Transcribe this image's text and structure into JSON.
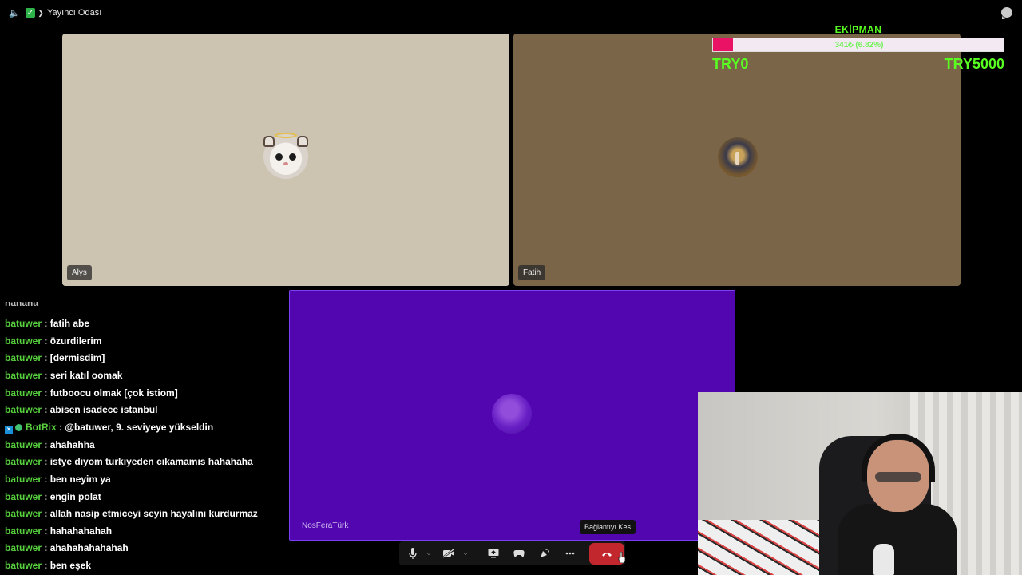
{
  "window": {
    "title": "Yayıncı Odası"
  },
  "participants": [
    {
      "name": "Alys"
    },
    {
      "name": "Fatih"
    },
    {
      "name": "NosFeraTürk"
    }
  ],
  "equipment_goal": {
    "title": "EKİPMAN",
    "progress_text": "341₺ (6.82%)",
    "progress_fraction": 0.0682,
    "min_label": "TRY0",
    "max_label": "TRY5000",
    "colors": {
      "accent": "#58ff20",
      "fill": "#ea1264"
    }
  },
  "chat": {
    "cut_off_line": "hahaha",
    "messages": [
      {
        "user": "batuwer",
        "text": "fatih abe"
      },
      {
        "user": "batuwer",
        "text": "özurdilerim"
      },
      {
        "user": "batuwer",
        "text": "[dermisdim]"
      },
      {
        "user": "batuwer",
        "text": "seri katıl oomak"
      },
      {
        "user": "batuwer",
        "text": "futboocu olmak [çok istiom]"
      },
      {
        "user": "batuwer",
        "text": "abisen isadece istanbul"
      },
      {
        "user": "BotRix",
        "text": "@batuwer, 9. seviyeye yükseldin",
        "bot": true
      },
      {
        "user": "batuwer",
        "text": "ahahahha"
      },
      {
        "user": "batuwer",
        "text": "istye dıyom turkıyeden cıkamamıs hahahaha"
      },
      {
        "user": "batuwer",
        "text": "ben neyim ya"
      },
      {
        "user": "batuwer",
        "text": "engin polat"
      },
      {
        "user": "batuwer",
        "text": "allah nasip etmiceyi seyin hayalını kurdurmaz"
      },
      {
        "user": "batuwer",
        "text": "hahahahahah"
      },
      {
        "user": "batuwer",
        "text": "ahahahahahahah"
      },
      {
        "user": "batuwer",
        "text": "ben eşek"
      }
    ],
    "separator": ":"
  },
  "controls": {
    "tooltip": "Bağlantıyı Kes",
    "buttons": [
      "microphone-icon",
      "camera-off-icon",
      "screen-share-icon",
      "activity-icon",
      "soundboard-icon",
      "more-icon",
      "disconnect-icon"
    ],
    "colors": {
      "disconnect": "#c2272d"
    }
  }
}
